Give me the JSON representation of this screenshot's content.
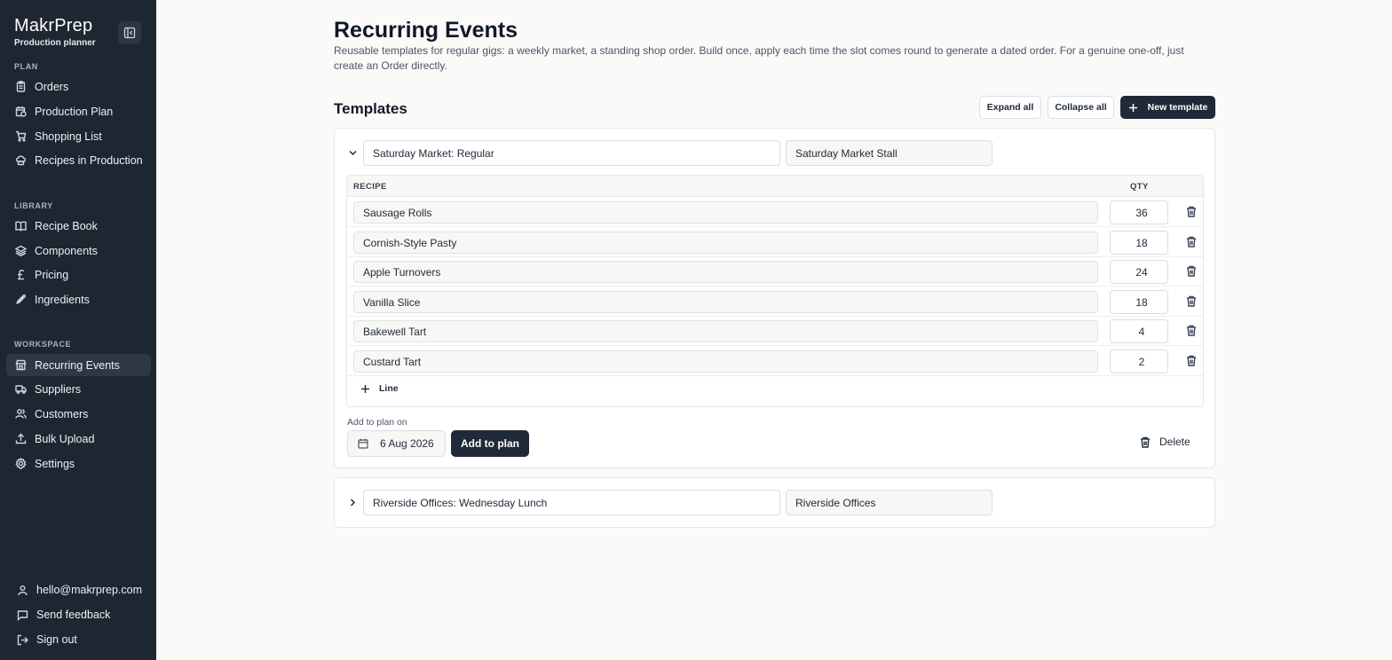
{
  "sidebar": {
    "brand": "MakrPrep",
    "subtitle": "Production planner",
    "sections": {
      "plan": "PLAN",
      "library": "LIBRARY",
      "workspace": "WORKSPACE"
    },
    "plan_items": [
      {
        "label": "Orders",
        "icon": "clipboard-icon"
      },
      {
        "label": "Production Plan",
        "icon": "calendar-clock-icon"
      },
      {
        "label": "Shopping List",
        "icon": "cart-icon"
      },
      {
        "label": "Recipes in Production",
        "icon": "chef-hat-icon"
      }
    ],
    "library_items": [
      {
        "label": "Recipe Book",
        "icon": "book-open-icon"
      },
      {
        "label": "Components",
        "icon": "layers-icon"
      },
      {
        "label": "Pricing",
        "icon": "pound-icon"
      },
      {
        "label": "Ingredients",
        "icon": "wheat-icon"
      }
    ],
    "workspace_items": [
      {
        "label": "Recurring Events",
        "icon": "store-icon",
        "active": true
      },
      {
        "label": "Suppliers",
        "icon": "truck-icon"
      },
      {
        "label": "Customers",
        "icon": "users-icon"
      },
      {
        "label": "Bulk Upload",
        "icon": "upload-icon"
      },
      {
        "label": "Settings",
        "icon": "gear-icon"
      }
    ],
    "footer": {
      "email": "hello@makrprep.com",
      "feedback": "Send feedback",
      "signout": "Sign out"
    }
  },
  "main": {
    "title": "Recurring Events",
    "description": "Reusable templates for regular gigs: a weekly market, a standing shop order. Build once, apply each time the slot comes round to generate a dated order. For a genuine one-off, just create an Order directly.",
    "templates_heading": "Templates",
    "expand_all": "Expand all",
    "collapse_all": "Collapse all",
    "new_template": "New template",
    "templates": [
      {
        "name": "Saturday Market: Regular",
        "customer": "Saturday Market Stall",
        "expanded": true,
        "col_recipe": "RECIPE",
        "col_qty": "QTY",
        "lines": [
          {
            "recipe": "Sausage Rolls",
            "qty": "36"
          },
          {
            "recipe": "Cornish-Style Pasty",
            "qty": "18"
          },
          {
            "recipe": "Apple Turnovers",
            "qty": "24"
          },
          {
            "recipe": "Vanilla Slice",
            "qty": "18"
          },
          {
            "recipe": "Bakewell Tart",
            "qty": "4"
          },
          {
            "recipe": "Custard Tart",
            "qty": "2"
          }
        ],
        "add_line": "Line",
        "plan_label": "Add to plan on",
        "plan_date": "6 Aug 2026",
        "add_to_plan": "Add to plan",
        "delete": "Delete"
      },
      {
        "name": "Riverside Offices: Wednesday Lunch",
        "customer": "Riverside Offices",
        "expanded": false
      }
    ]
  }
}
